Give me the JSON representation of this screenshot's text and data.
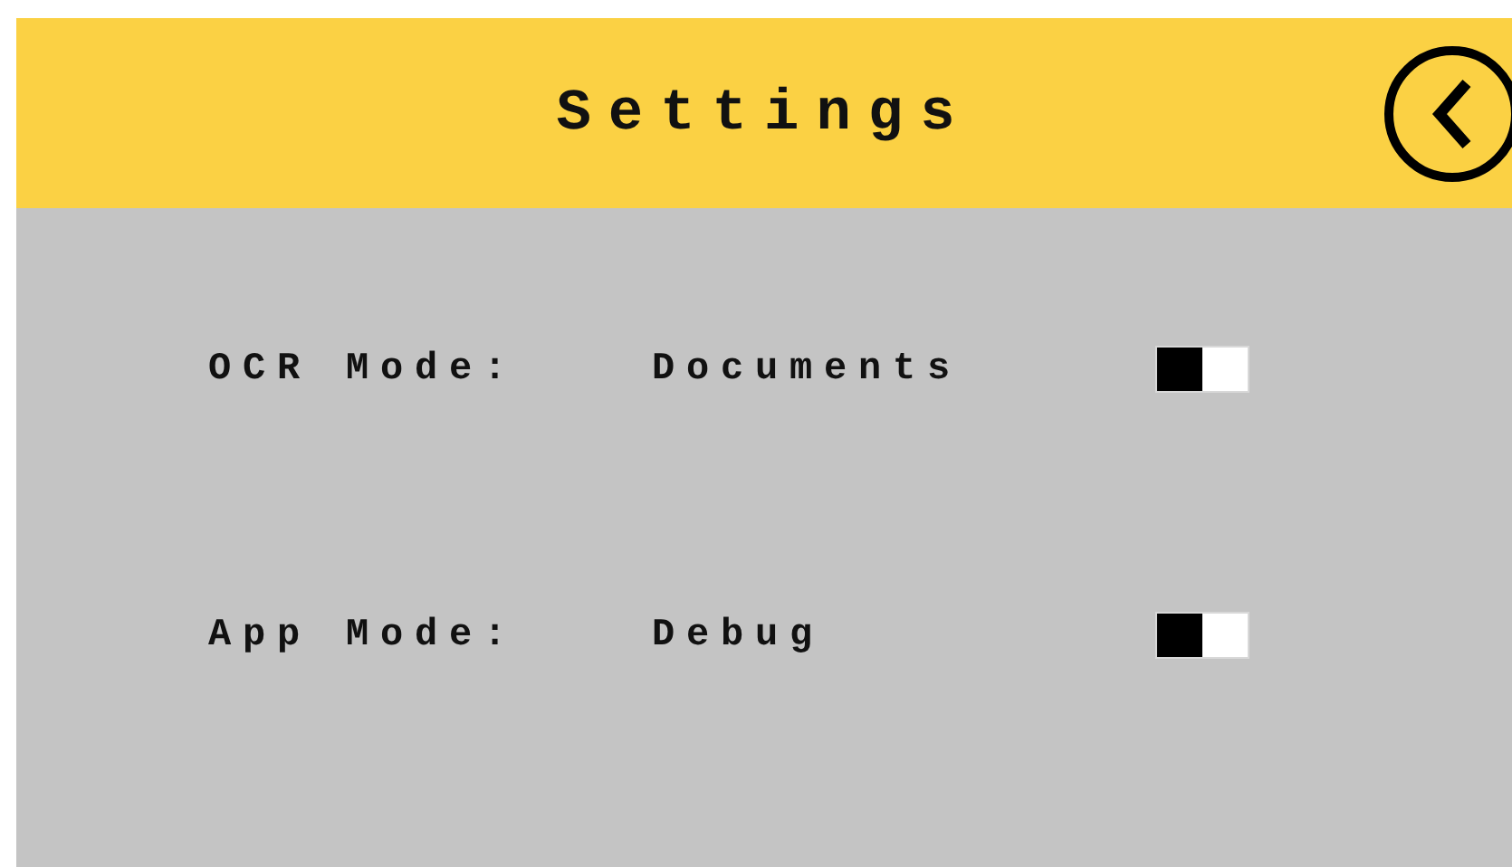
{
  "header": {
    "title": "Settings"
  },
  "settings": [
    {
      "label": "OCR Mode:",
      "value": "Documents",
      "on": false
    },
    {
      "label": "App Mode:",
      "value": "Debug",
      "on": false
    }
  ]
}
